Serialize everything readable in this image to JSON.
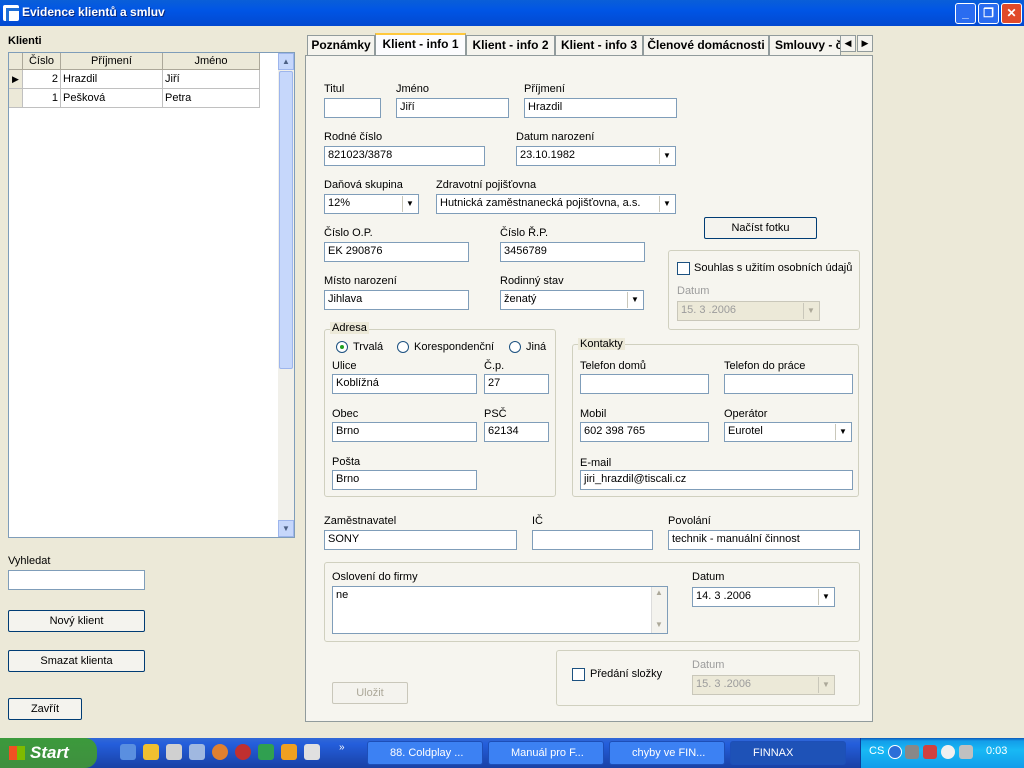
{
  "window": {
    "title": "Evidence klientů a smluv"
  },
  "clients": {
    "heading": "Klienti",
    "columns": [
      "Číslo",
      "Příjmení",
      "Jméno"
    ],
    "rows": [
      {
        "cislo": "2",
        "prijmeni": "Hrazdil",
        "jmeno": "Jiří"
      },
      {
        "cislo": "1",
        "prijmeni": "Pešková",
        "jmeno": "Petra"
      }
    ]
  },
  "search": {
    "label": "Vyhledat",
    "value": ""
  },
  "buttons": {
    "new_client": "Nový klient",
    "delete_client": "Smazat klienta",
    "close": "Zavřít",
    "load_photo": "Načíst fotku",
    "save": "Uložit"
  },
  "tabs": [
    "Poznámky",
    "Klient - info 1",
    "Klient - info 2",
    "Klient - info 3",
    "Členové domácnosti",
    "Smlouvy - č"
  ],
  "form": {
    "titul": {
      "label": "Titul",
      "value": ""
    },
    "jmeno": {
      "label": "Jméno",
      "value": "Jiří"
    },
    "prijmeni": {
      "label": "Příjmení",
      "value": "Hrazdil"
    },
    "rodne_cislo": {
      "label": "Rodné číslo",
      "value": "821023/3878"
    },
    "datum_narozeni": {
      "label": "Datum narození",
      "value": "23.10.1982"
    },
    "danova_skupina": {
      "label": "Daňová skupina",
      "value": "12%"
    },
    "pojistovna": {
      "label": "Zdravotní pojišťovna",
      "value": "Hutnická zaměstnanecká pojišťovna, a.s."
    },
    "cislo_op": {
      "label": "Číslo O.P.",
      "value": "EK 290876"
    },
    "cislo_rp": {
      "label": "Číslo Ř.P.",
      "value": "3456789"
    },
    "misto_narozeni": {
      "label": "Místo narození",
      "value": "Jihlava"
    },
    "rodinny_stav": {
      "label": "Rodinný stav",
      "value": "ženatý"
    },
    "souhlas": {
      "label": "Souhlas s užitím osobních údajů",
      "checked": false,
      "datum_label": "Datum",
      "datum_value": "15. 3 .2006"
    },
    "adresa": {
      "title": "Adresa",
      "options": [
        "Trvalá",
        "Korespondenční",
        "Jiná"
      ],
      "selected": "Trvalá",
      "ulice": {
        "label": "Ulice",
        "value": "Koblížná"
      },
      "cp": {
        "label": "Č.p.",
        "value": "27"
      },
      "obec": {
        "label": "Obec",
        "value": "Brno"
      },
      "psc": {
        "label": "PSČ",
        "value": "62134"
      },
      "posta": {
        "label": "Pošta",
        "value": "Brno"
      }
    },
    "kontakty": {
      "title": "Kontakty",
      "tel_domu": {
        "label": "Telefon domů",
        "value": ""
      },
      "tel_prace": {
        "label": "Telefon do práce",
        "value": ""
      },
      "mobil": {
        "label": "Mobil",
        "value": "602 398 765"
      },
      "operator": {
        "label": "Operátor",
        "value": "Eurotel"
      },
      "email": {
        "label": "E-mail",
        "value": "jiri_hrazdil@tiscali.cz"
      }
    },
    "zamestnavatel": {
      "label": "Zaměstnavatel",
      "value": "SONY"
    },
    "ic": {
      "label": "IČ",
      "value": ""
    },
    "povolani": {
      "label": "Povolání",
      "value": "technik - manuální činnost"
    },
    "osloveni": {
      "label": "Oslovení do firmy",
      "value": "ne",
      "datum_label": "Datum",
      "datum_value": "14. 3 .2006"
    },
    "predani": {
      "label": "Předání složky",
      "checked": false,
      "datum_label": "Datum",
      "datum_value": "15. 3 .2006"
    }
  },
  "taskbar": {
    "start": "Start",
    "tasks": [
      "88. Coldplay ...",
      "Manuál pro F...",
      "chyby ve FIN...",
      "FINNAX"
    ],
    "lang": "CS",
    "clock": "0:03"
  }
}
